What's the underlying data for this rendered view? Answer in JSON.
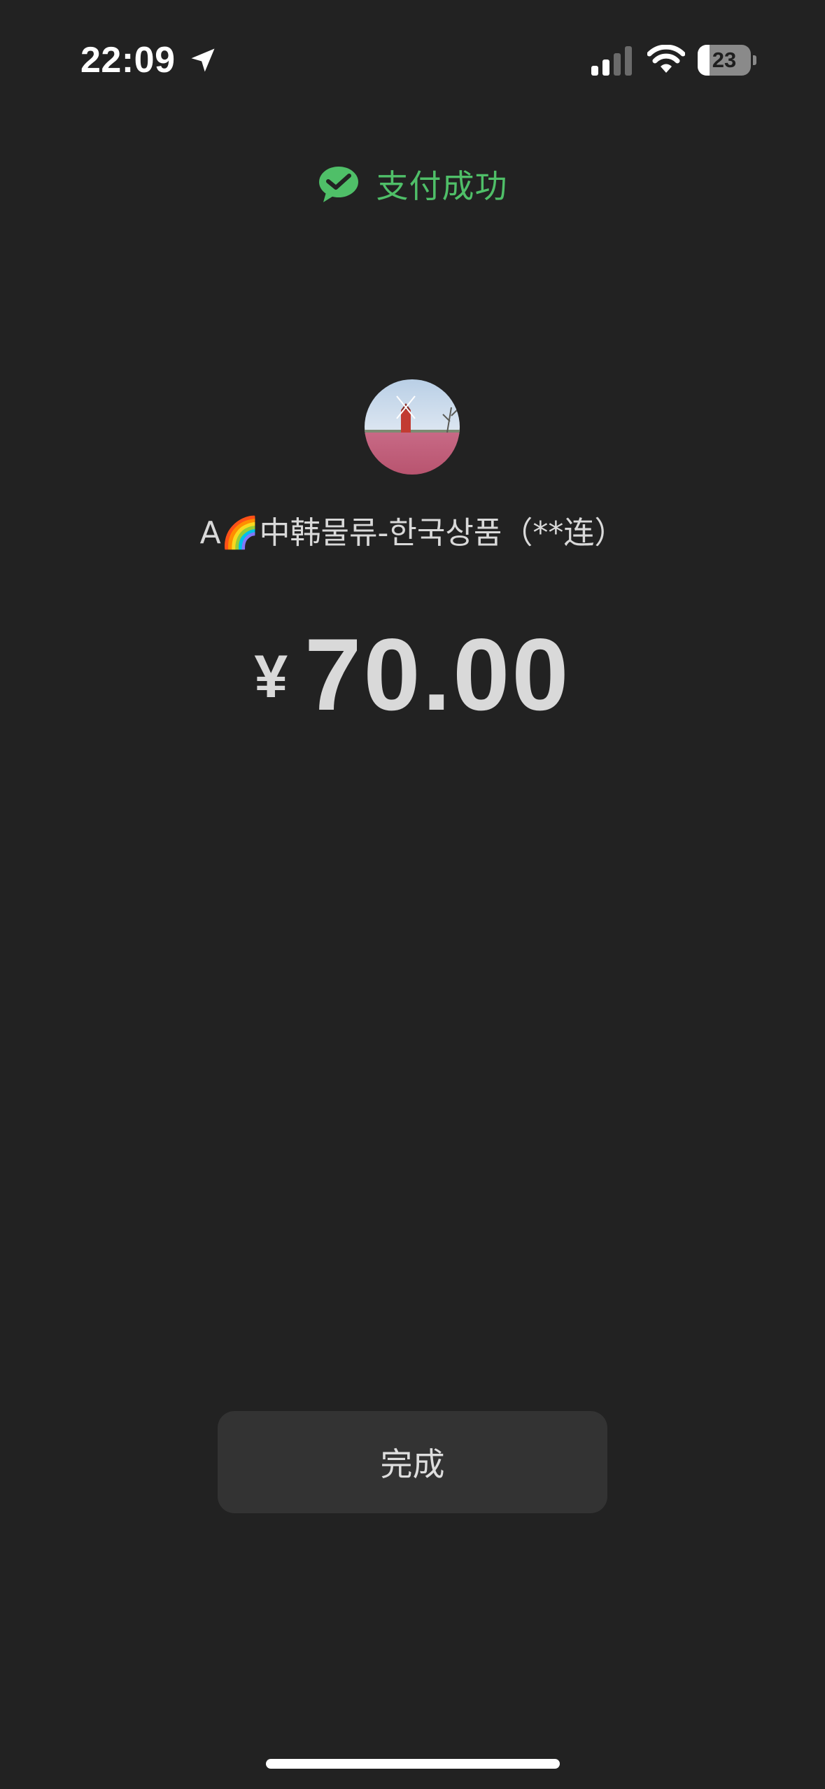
{
  "status_bar": {
    "time": "22:09",
    "battery_level": "23",
    "battery_fraction": 0.23,
    "icons": [
      "location-arrow-icon",
      "cellular-signal-icon",
      "wifi-icon",
      "battery-icon"
    ]
  },
  "header": {
    "status_text": "支付成功",
    "icon": "wechat-pay-icon",
    "accent_color": "#4fbf68"
  },
  "merchant": {
    "name": "A🌈中韩물류-한국상품（**连）",
    "avatar": "windmill-photo-avatar"
  },
  "payment": {
    "currency_symbol": "¥",
    "amount": "70.00"
  },
  "actions": {
    "done_label": "完成"
  }
}
